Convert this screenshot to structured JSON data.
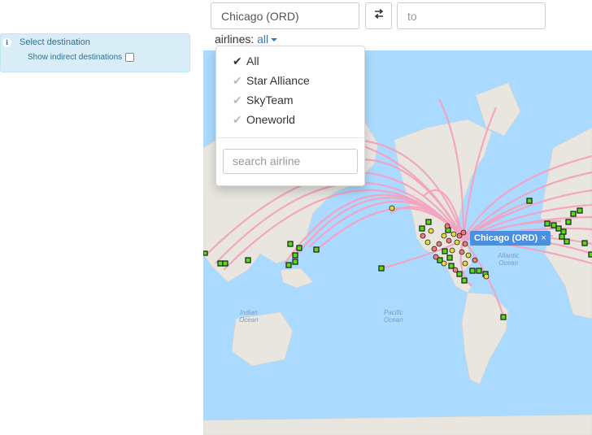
{
  "info_panel": {
    "title": "Select destination",
    "indirect_label": "Show indirect destinations"
  },
  "search": {
    "from_value": "Chicago (ORD)",
    "to_placeholder": "to",
    "swap_icon": "swap-arrows-icon"
  },
  "airlines": {
    "label": "airlines:",
    "selected": "all"
  },
  "dropdown": {
    "items": [
      {
        "label": "All",
        "checked": true
      },
      {
        "label": "Star Alliance",
        "checked": false
      },
      {
        "label": "SkyTeam",
        "checked": false
      },
      {
        "label": "Oneworld",
        "checked": false
      }
    ],
    "search_placeholder": "search airline"
  },
  "map": {
    "origin_label": "Chicago (ORD)",
    "close_symbol": "×",
    "oceans": [
      {
        "line1": "Indian",
        "line2": "Ocean"
      },
      {
        "line1": "Pacific",
        "line2": "Ocean"
      },
      {
        "line1": "Atlantic",
        "line2": "Ocean"
      }
    ],
    "colors": {
      "water": "#aadaff",
      "land": "#e8e6df",
      "route": "#f4a3c0",
      "airport": "#55dd11",
      "accent": "#4a90e2"
    }
  }
}
